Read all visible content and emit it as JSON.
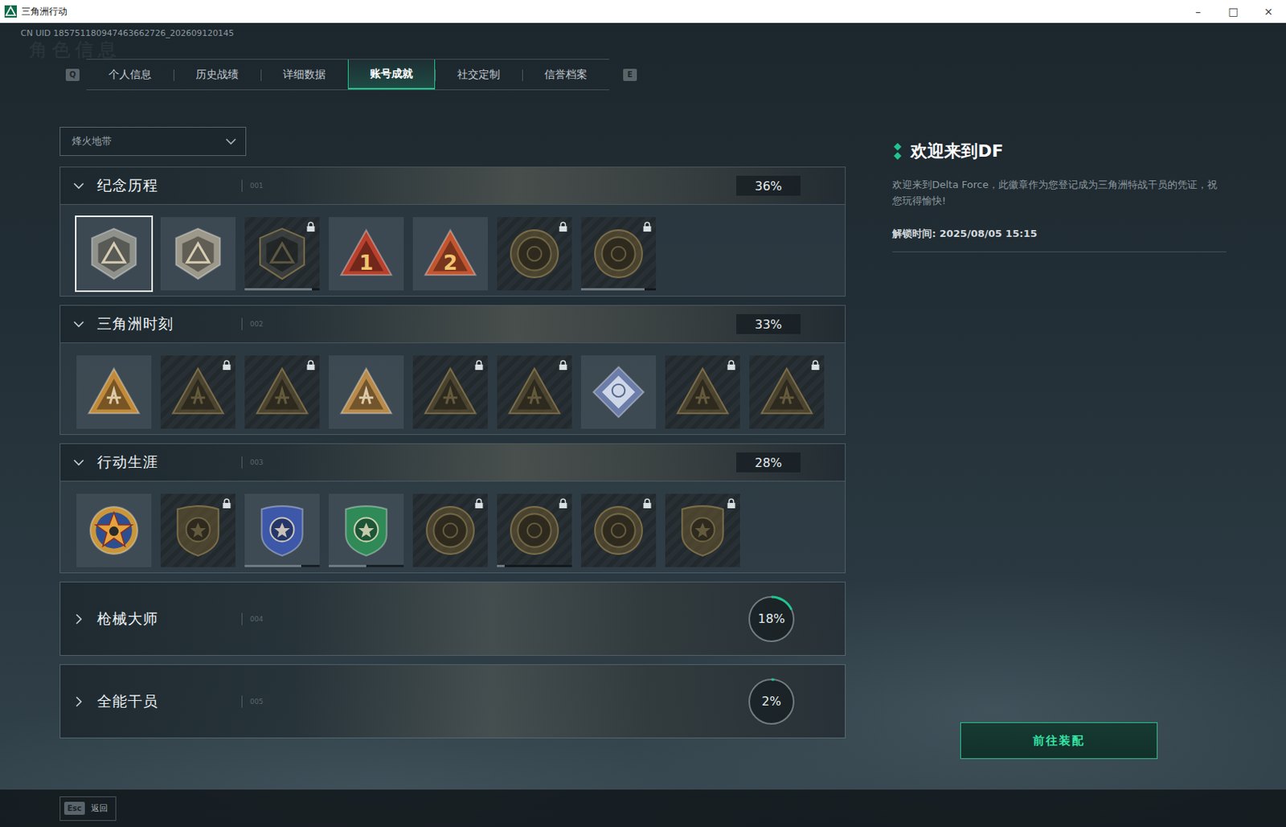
{
  "window": {
    "title": "三角洲行动",
    "controls": [
      "–",
      "□",
      "×"
    ]
  },
  "uid": "CN UID 185751180947463662726_202609120145",
  "watermark": "角色信息",
  "tab_keys": {
    "prev": "Q",
    "next": "E"
  },
  "tabs": [
    {
      "label": "个人信息",
      "selected": false
    },
    {
      "label": "历史战绩",
      "selected": false
    },
    {
      "label": "详细数据",
      "selected": false
    },
    {
      "label": "账号成就",
      "selected": true
    },
    {
      "label": "社交定制",
      "selected": false
    },
    {
      "label": "信誉档案",
      "selected": false
    }
  ],
  "mode_select": {
    "value": "烽火地带",
    "expanded": false
  },
  "sections": [
    {
      "title": "纪念历程",
      "index": "001",
      "percent": "36%",
      "expanded": true,
      "badges": [
        {
          "kind": "hex",
          "color": "#8f918b",
          "locked": false,
          "selected": true
        },
        {
          "kind": "hex",
          "color": "#9c988a",
          "locked": false,
          "selected": false
        },
        {
          "kind": "hex",
          "color": "#4a4d48",
          "locked": true,
          "selected": false,
          "level": 0.9
        },
        {
          "kind": "triangle",
          "color": "#b8402c",
          "locked": false,
          "selected": false,
          "glyph": "1"
        },
        {
          "kind": "triangle",
          "color": "#c2552f",
          "locked": false,
          "selected": false,
          "glyph": "2"
        },
        {
          "kind": "medal",
          "color": "#6a5830",
          "locked": true,
          "selected": false
        },
        {
          "kind": "medal",
          "color": "#6a5830",
          "locked": true,
          "selected": false,
          "level": 0.85
        }
      ]
    },
    {
      "title": "三角洲时刻",
      "index": "002",
      "percent": "33%",
      "expanded": true,
      "badges": [
        {
          "kind": "triangle",
          "color": "#c08a3a",
          "locked": false,
          "selected": false
        },
        {
          "kind": "triangle",
          "color": "#6a5830",
          "locked": true,
          "selected": false
        },
        {
          "kind": "triangle",
          "color": "#6a5830",
          "locked": true,
          "selected": false
        },
        {
          "kind": "triangle",
          "color": "#b88a4a",
          "locked": false,
          "selected": false
        },
        {
          "kind": "triangle",
          "color": "#6a5830",
          "locked": true,
          "selected": false
        },
        {
          "kind": "triangle",
          "color": "#6a5830",
          "locked": true,
          "selected": false
        },
        {
          "kind": "diamond",
          "color": "#6b7da8",
          "locked": false,
          "selected": false
        },
        {
          "kind": "triangle",
          "color": "#6a5830",
          "locked": true,
          "selected": false
        },
        {
          "kind": "triangle",
          "color": "#6a5830",
          "locked": true,
          "selected": false
        }
      ]
    },
    {
      "title": "行动生涯",
      "index": "003",
      "percent": "28%",
      "expanded": true,
      "badges": [
        {
          "kind": "star",
          "color": "#c9963a",
          "locked": false,
          "selected": false
        },
        {
          "kind": "shield",
          "color": "#6a5830",
          "locked": true,
          "selected": false
        },
        {
          "kind": "shield",
          "color": "#3d58a8",
          "locked": false,
          "selected": false,
          "level": 0.75
        },
        {
          "kind": "shield",
          "color": "#2f8a57",
          "locked": false,
          "selected": false,
          "level": 0.5
        },
        {
          "kind": "medal",
          "color": "#6a5830",
          "locked": true,
          "selected": false
        },
        {
          "kind": "medal",
          "color": "#6a5830",
          "locked": true,
          "selected": false,
          "level": 0.1
        },
        {
          "kind": "medal",
          "color": "#6a5830",
          "locked": true,
          "selected": false
        },
        {
          "kind": "shield",
          "color": "#6a5830",
          "locked": true,
          "selected": false
        }
      ]
    },
    {
      "title": "枪械大师",
      "index": "004",
      "percent": "18%",
      "level": 0.18,
      "expanded": false,
      "badges": []
    },
    {
      "title": "全能干员",
      "index": "005",
      "percent": "2%",
      "level": 0.02,
      "expanded": false,
      "badges": []
    }
  ],
  "detail": {
    "title": "欢迎来到DF",
    "description": "欢迎来到Delta Force，此徽章作为您登记成为三角洲特战干员的凭证，祝您玩得愉快!",
    "unlock_time": "解锁时间: 2025/08/05 15:15",
    "button": "前往装配"
  },
  "footer": {
    "key": "Esc",
    "label": "返回"
  }
}
